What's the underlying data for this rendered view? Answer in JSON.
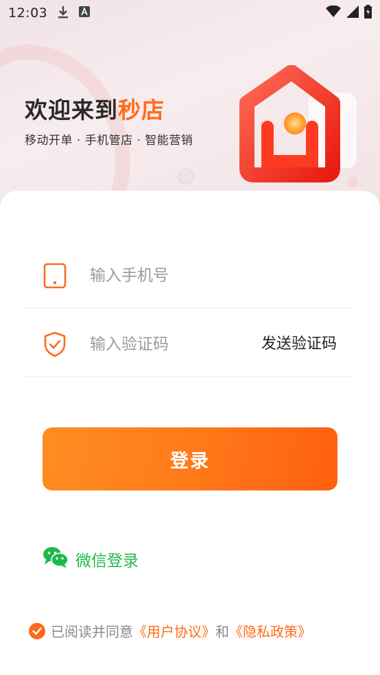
{
  "status_bar": {
    "time": "12:03",
    "icons": [
      "download-icon",
      "a-font-icon",
      "wifi-icon",
      "signal-icon",
      "battery-icon"
    ]
  },
  "hero": {
    "title_prefix": "欢迎来到",
    "title_accent": "秒店",
    "subtitle": "移动开单 · 手机管店 · 智能营销"
  },
  "form": {
    "phone_placeholder": "输入手机号",
    "code_placeholder": "输入验证码",
    "send_code_label": "发送验证码",
    "login_label": "登录"
  },
  "wechat_login_label": "微信登录",
  "agreement": {
    "prefix": "已阅读并同意",
    "user_agreement": "《用户协议》",
    "and": "和",
    "privacy_policy": "《隐私政策》",
    "checked": true
  },
  "colors": {
    "accent": "#ff6a1a",
    "wechat_green": "#1fb94a"
  }
}
